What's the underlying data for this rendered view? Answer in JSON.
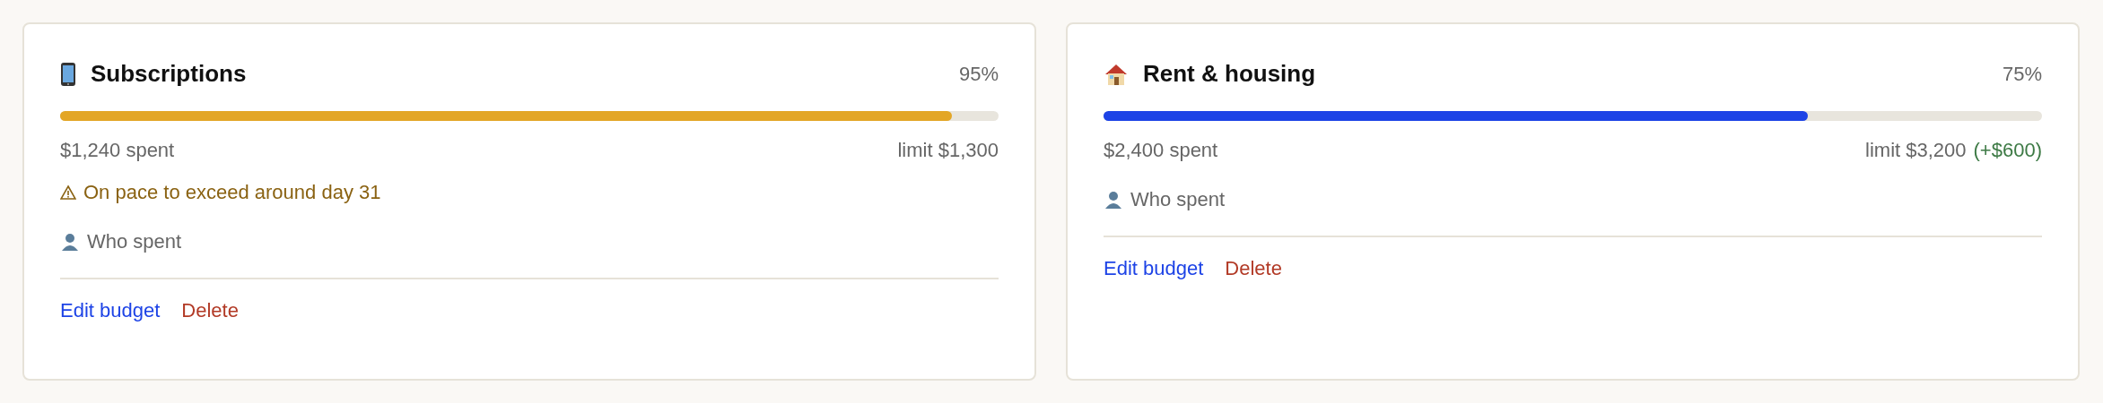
{
  "budgets": [
    {
      "kind": "phone",
      "name": "Subscriptions",
      "percent": "95%",
      "level": 0.95,
      "color": "#e3a626",
      "spent": "$1,240 spent",
      "limit": "limit $1,300",
      "warning": "On pace to exceed around day 31",
      "who_spent": "Who spent",
      "actions": [
        "Edit budget",
        "Delete"
      ]
    },
    {
      "kind": "house",
      "name": "Rent & housing",
      "percent": "75%",
      "level": 0.75,
      "color": "#1d43e6",
      "spent": "$2,400 spent",
      "limit": "limit $3,200",
      "limit_extra": "(+$600)",
      "who_spent": "Who spent",
      "actions": [
        "Edit budget",
        "Delete"
      ]
    }
  ]
}
